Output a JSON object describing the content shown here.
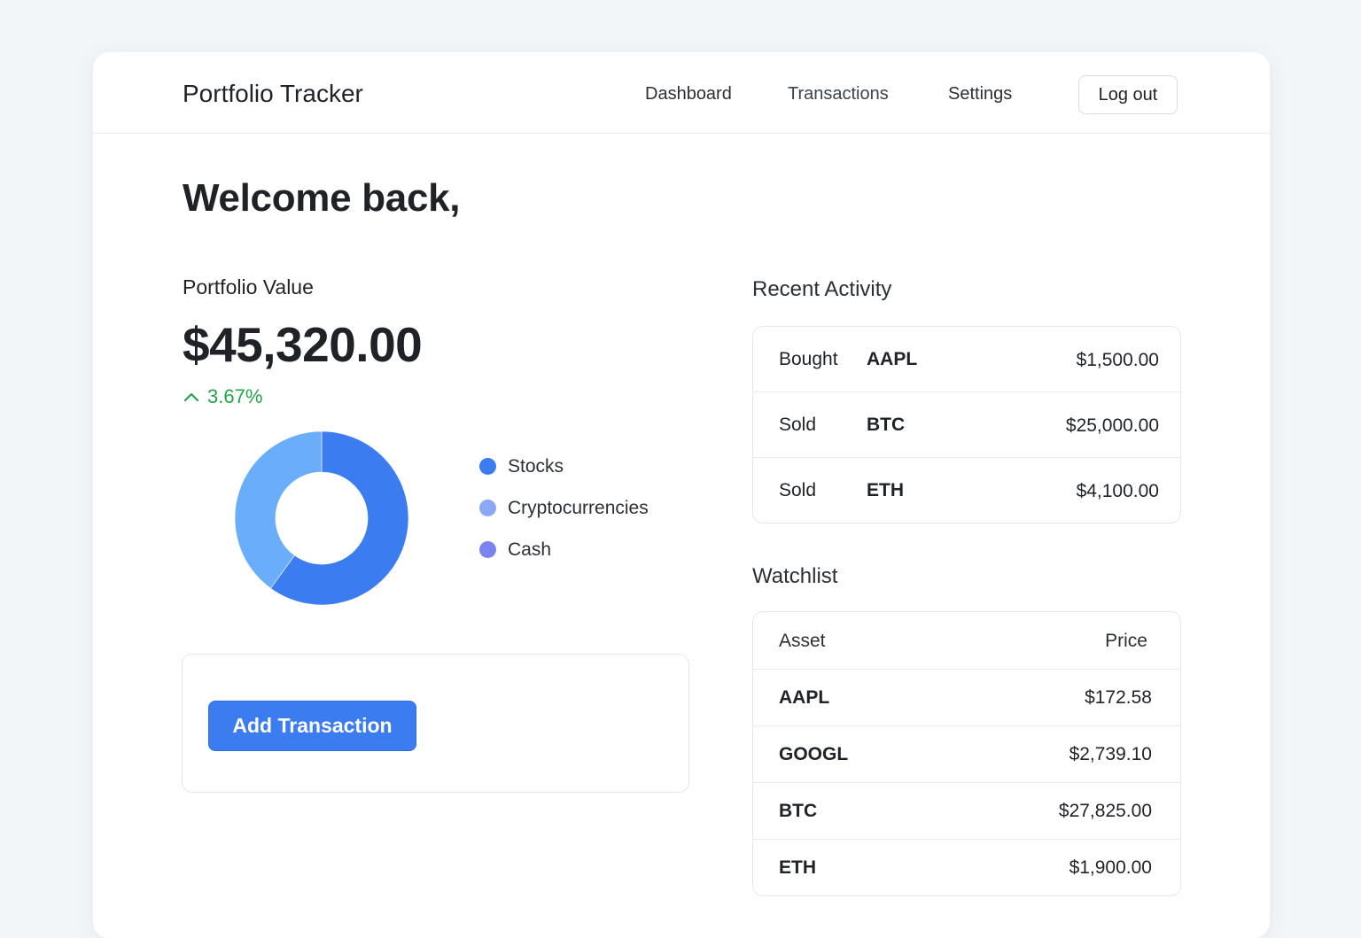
{
  "header": {
    "title": "Portfolio Tracker",
    "nav": [
      "Dashboard",
      "Transactions",
      "Settings"
    ],
    "logout_label": "Log out"
  },
  "welcome": "Welcome back,",
  "portfolio": {
    "label": "Portfolio Value",
    "value": "$45,320.00",
    "change": "3.67%",
    "change_direction": "up",
    "change_color": "#22a447"
  },
  "allocation": {
    "legend": [
      {
        "label": "Stocks",
        "color": "#3b7cf0"
      },
      {
        "label": "Cryptocurrencies",
        "color": "#8aa8f5"
      },
      {
        "label": "Cash",
        "color": "#7a84ee"
      }
    ],
    "slices": [
      {
        "share": 0.6,
        "color": "#3b7cf0"
      },
      {
        "share": 0.4,
        "color": "#6aaefb"
      }
    ]
  },
  "actions": {
    "add_transaction_label": "Add Transaction",
    "accent": "#3b7cf0"
  },
  "recent_activity": {
    "title": "Recent Activity",
    "rows": [
      {
        "action": "Bought",
        "asset": "AAPL",
        "amount": "$1,500.00"
      },
      {
        "action": "Sold",
        "asset": "BTC",
        "amount": "$25,000.00"
      },
      {
        "action": "Sold",
        "asset": "ETH",
        "amount": "$4,100.00"
      }
    ]
  },
  "watchlist": {
    "title": "Watchlist",
    "columns": [
      "Asset",
      "Price"
    ],
    "rows": [
      {
        "asset": "AAPL",
        "price": "$172.58"
      },
      {
        "asset": "GOOGL",
        "price": "$2,739.10"
      },
      {
        "asset": "BTC",
        "price": "$27,825.00"
      },
      {
        "asset": "ETH",
        "price": "$1,900.00"
      }
    ]
  }
}
